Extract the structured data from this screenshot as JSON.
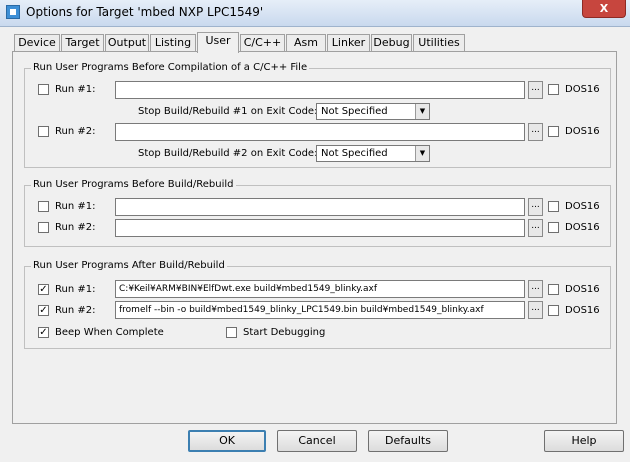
{
  "window": {
    "title": "Options for Target 'mbed NXP LPC1549'",
    "close_label": "X"
  },
  "tabs": [
    {
      "label": "Device"
    },
    {
      "label": "Target"
    },
    {
      "label": "Output"
    },
    {
      "label": "Listing"
    },
    {
      "label": "User"
    },
    {
      "label": "C/C++"
    },
    {
      "label": "Asm"
    },
    {
      "label": "Linker"
    },
    {
      "label": "Debug"
    },
    {
      "label": "Utilities"
    }
  ],
  "active_tab": "User",
  "before_compile": {
    "title": "Run User Programs Before Compilation of a C/C++ File",
    "run1": {
      "label": "Run #1:",
      "checked": false,
      "value": "",
      "browse": "...",
      "dos16_label": "DOS16",
      "dos16": false
    },
    "stop1": {
      "label": "Stop Build/Rebuild #1 on Exit Code:",
      "value": "Not Specified"
    },
    "run2": {
      "label": "Run #2:",
      "checked": false,
      "value": "",
      "browse": "...",
      "dos16_label": "DOS16",
      "dos16": false
    },
    "stop2": {
      "label": "Stop Build/Rebuild #2 on Exit Code:",
      "value": "Not Specified"
    }
  },
  "before_build": {
    "title": "Run User Programs Before Build/Rebuild",
    "run1": {
      "label": "Run #1:",
      "checked": false,
      "value": "",
      "browse": "...",
      "dos16_label": "DOS16",
      "dos16": false
    },
    "run2": {
      "label": "Run #2:",
      "checked": false,
      "value": "",
      "browse": "...",
      "dos16_label": "DOS16",
      "dos16": false
    }
  },
  "after_build": {
    "title": "Run User Programs After Build/Rebuild",
    "run1": {
      "label": "Run #1:",
      "checked": true,
      "value": "C:¥Keil¥ARM¥BIN¥ElfDwt.exe build¥mbed1549_blinky.axf",
      "browse": "...",
      "dos16_label": "DOS16",
      "dos16": false
    },
    "run2": {
      "label": "Run #2:",
      "checked": true,
      "value": "fromelf --bin -o build¥mbed1549_blinky_LPC1549.bin build¥mbed1549_blinky.axf",
      "browse": "...",
      "dos16_label": "DOS16",
      "dos16": false
    },
    "beep": {
      "label": "Beep When Complete",
      "checked": true
    },
    "start_debug": {
      "label": "Start Debugging",
      "checked": false
    }
  },
  "buttons": {
    "ok": "OK",
    "cancel": "Cancel",
    "defaults": "Defaults",
    "help": "Help"
  },
  "check_glyph": "✓"
}
